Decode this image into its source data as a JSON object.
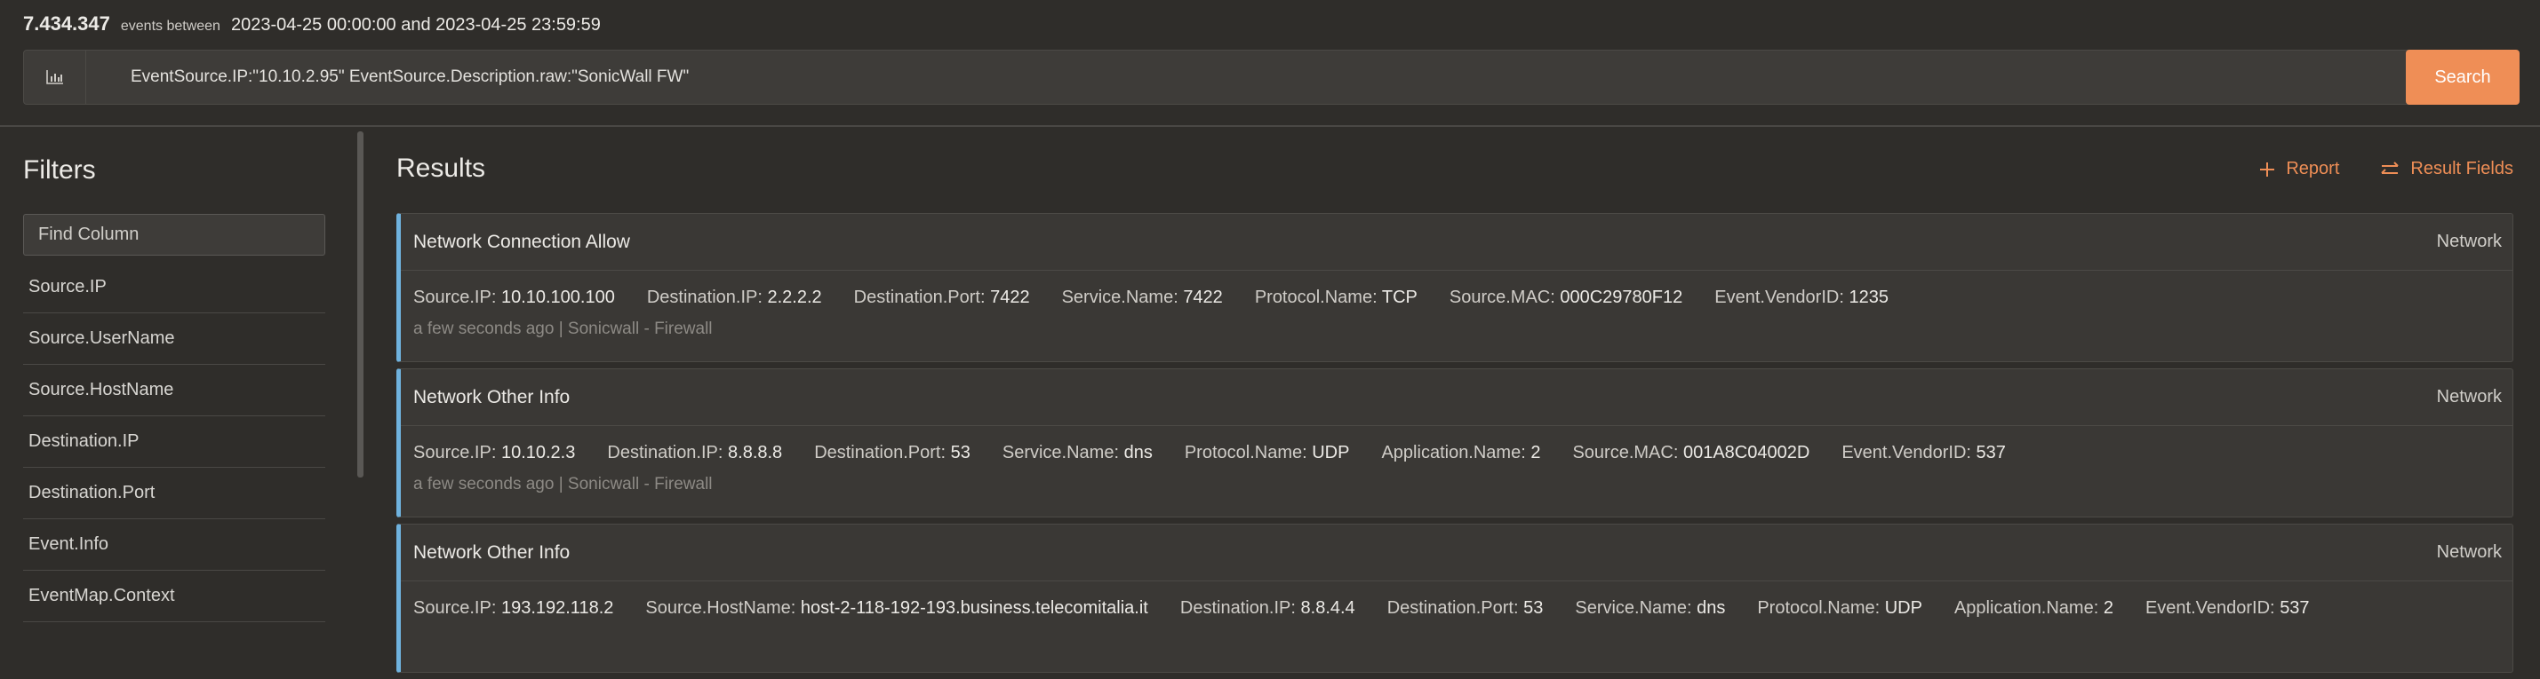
{
  "summary": {
    "count": "7.434.347",
    "between": "events between",
    "range": "2023-04-25 00:00:00 and 2023-04-25 23:59:59"
  },
  "search": {
    "query": "EventSource.IP:\"10.10.2.95\" EventSource.Description.raw:\"SonicWall FW\"",
    "button": "Search"
  },
  "filters": {
    "title": "Filters",
    "find_placeholder": "Find Column",
    "columns": [
      "Source.IP",
      "Source.UserName",
      "Source.HostName",
      "Destination.IP",
      "Destination.Port",
      "Event.Info",
      "EventMap.Context"
    ]
  },
  "results": {
    "title": "Results",
    "report_label": "Report",
    "fields_label": "Result Fields",
    "accent": "#ef8e56",
    "events": [
      {
        "title": "Network Connection Allow",
        "category": "Network",
        "fields": [
          {
            "k": "Source.IP:",
            "v": "10.10.100.100"
          },
          {
            "k": "Destination.IP:",
            "v": "2.2.2.2"
          },
          {
            "k": "Destination.Port:",
            "v": "7422"
          },
          {
            "k": "Service.Name:",
            "v": "7422"
          },
          {
            "k": "Protocol.Name:",
            "v": "TCP"
          },
          {
            "k": "Source.MAC:",
            "v": "000C29780F12"
          },
          {
            "k": "Event.VendorID:",
            "v": "1235"
          }
        ],
        "footer": "a few seconds ago | Sonicwall - Firewall"
      },
      {
        "title": "Network Other Info",
        "category": "Network",
        "fields": [
          {
            "k": "Source.IP:",
            "v": "10.10.2.3"
          },
          {
            "k": "Destination.IP:",
            "v": "8.8.8.8"
          },
          {
            "k": "Destination.Port:",
            "v": "53"
          },
          {
            "k": "Service.Name:",
            "v": "dns"
          },
          {
            "k": "Protocol.Name:",
            "v": "UDP"
          },
          {
            "k": "Application.Name:",
            "v": "2"
          },
          {
            "k": "Source.MAC:",
            "v": "001A8C04002D"
          },
          {
            "k": "Event.VendorID:",
            "v": "537"
          }
        ],
        "footer": "a few seconds ago | Sonicwall - Firewall"
      },
      {
        "title": "Network Other Info",
        "category": "Network",
        "fields": [
          {
            "k": "Source.IP:",
            "v": "193.192.118.2"
          },
          {
            "k": "Source.HostName:",
            "v": "host-2-118-192-193.business.telecomitalia.it"
          },
          {
            "k": "Destination.IP:",
            "v": "8.8.4.4"
          },
          {
            "k": "Destination.Port:",
            "v": "53"
          },
          {
            "k": "Service.Name:",
            "v": "dns"
          },
          {
            "k": "Protocol.Name:",
            "v": "UDP"
          },
          {
            "k": "Application.Name:",
            "v": "2"
          },
          {
            "k": "Event.VendorID:",
            "v": "537"
          }
        ],
        "footer": ""
      }
    ]
  }
}
